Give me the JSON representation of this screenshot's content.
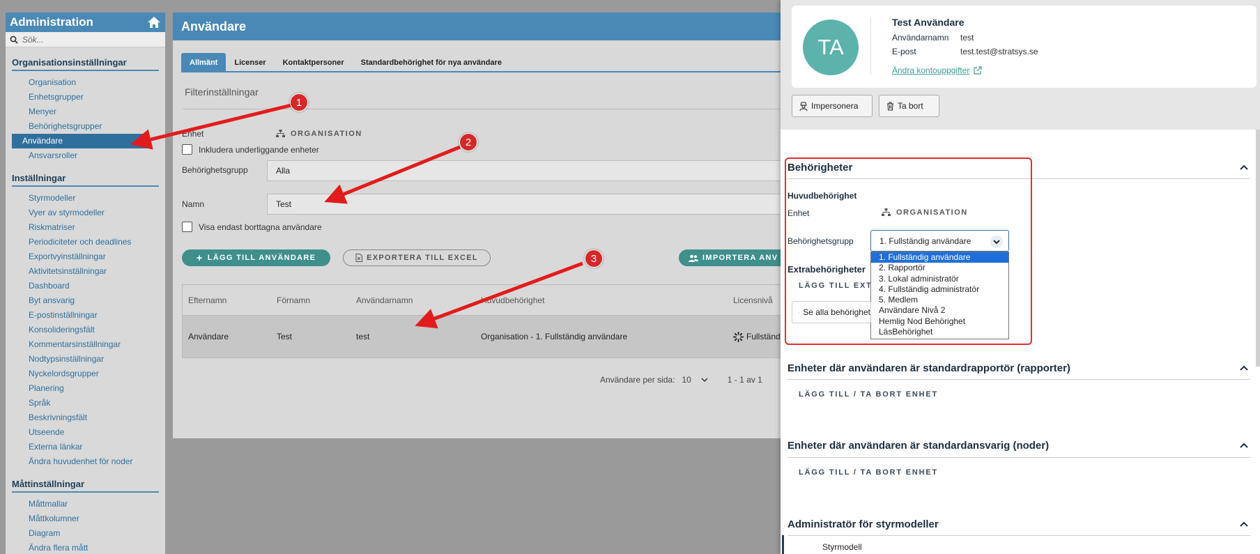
{
  "sidebar": {
    "title": "Administration",
    "search_placeholder": "Sök...",
    "sections": [
      {
        "title": "Organisationsinställningar",
        "items": [
          "Organisation",
          "Enhetsgrupper",
          "Menyer",
          "Behörighetsgrupper",
          "Användare",
          "Ansvarsroller"
        ]
      },
      {
        "title": "Inställningar",
        "items": [
          "Styrmodeller",
          "Vyer av styrmodeller",
          "Riskmatriser",
          "Periodiciteter och deadlines",
          "Exportvyinställningar",
          "Aktivitetsinställningar",
          "Dashboard",
          "Byt ansvarig",
          "E-postinställningar",
          "Konsolideringsfält",
          "Kommentarsinställningar",
          "Nodtypsinställningar",
          "Nyckelordsgrupper",
          "Planering",
          "Språk",
          "Beskrivningsfält",
          "Utseende",
          "Externa länkar",
          "Ändra huvudenhet för noder"
        ]
      },
      {
        "title": "Måttinställningar",
        "items": [
          "Måttmallar",
          "Måttkolumner",
          "Diagram",
          "Ändra flera mått"
        ]
      }
    ],
    "active_item": "Användare"
  },
  "main": {
    "title": "Användare",
    "tabs": [
      "Allmänt",
      "Licenser",
      "Kontaktpersoner",
      "Standardbehörighet för nya användare"
    ],
    "filter_title": "Filterinställningar",
    "unit_label": "Enhet",
    "unit_value": "ORGANISATION",
    "include_sub_label": "Inkludera underliggande enheter",
    "perm_group_label": "Behörighetsgrupp",
    "perm_group_value": "Alla",
    "name_label": "Namn",
    "name_value": "Test",
    "show_deleted_label": "Visa endast borttagna användare",
    "add_user_button": "LÄGG TILL ANVÄNDARE",
    "export_button": "EXPORTERA TILL EXCEL",
    "import_button": "IMPORTERA ANV",
    "table": {
      "headers": [
        "Efternamn",
        "Förnamn",
        "Användarnamn",
        "Huvudbehörighet",
        "Licensnivå"
      ],
      "rows": [
        [
          "Användare",
          "Test",
          "test",
          "Organisation - 1. Fullständig användare",
          "Fullständ"
        ]
      ]
    },
    "pagination": {
      "per_page_label": "Användare per sida:",
      "per_page_value": "10",
      "range": "1 - 1 av 1"
    }
  },
  "panel": {
    "avatar_initials": "TA",
    "user_name": "Test Användare",
    "username_label": "Användarnamn",
    "username_value": "test",
    "email_label": "E-post",
    "email_value": "test.test@stratsys.se",
    "account_link": "Ändra kontouppgifter",
    "impersonate_button": "Impersonera",
    "delete_button": "Ta bort",
    "permissions": {
      "title": "Behörigheter",
      "main_label": "Huvudbehörighet",
      "unit_label": "Enhet",
      "unit_value": "ORGANISATION",
      "group_label": "Behörighetsgrupp",
      "group_selected": "1. Fullständig användare",
      "options": [
        "1. Fullständig användare",
        "2. Rapportör",
        "3. Lokal administratör",
        "4. Fullständig administratör",
        "5. Medlem",
        "Användare Nivå 2",
        "Hemlig Nod Behörighet",
        "LäsBehörighet"
      ],
      "extra_label": "Extrabehörigheter",
      "extra_add": "LÄGG TILL EXTR",
      "see_all_button": "Se alla behörighet"
    },
    "reporter_section": {
      "title": "Enheter där användaren är standardrapportör (rapporter)",
      "link": "LÄGG TILL / TA BORT ENHET"
    },
    "responsible_section": {
      "title": "Enheter där användaren är standardansvarig (noder)",
      "link": "LÄGG TILL / TA BORT ENHET"
    },
    "admin_section": {
      "title": "Administratör för styrmodeller",
      "first_row": "Styrmodell"
    }
  },
  "annotations": {
    "markers": [
      "1",
      "2",
      "3"
    ]
  },
  "colors": {
    "accent": "#4a89b6",
    "teal": "#3f8f8c",
    "highlight": "#e03030",
    "marker": "#d62828"
  }
}
